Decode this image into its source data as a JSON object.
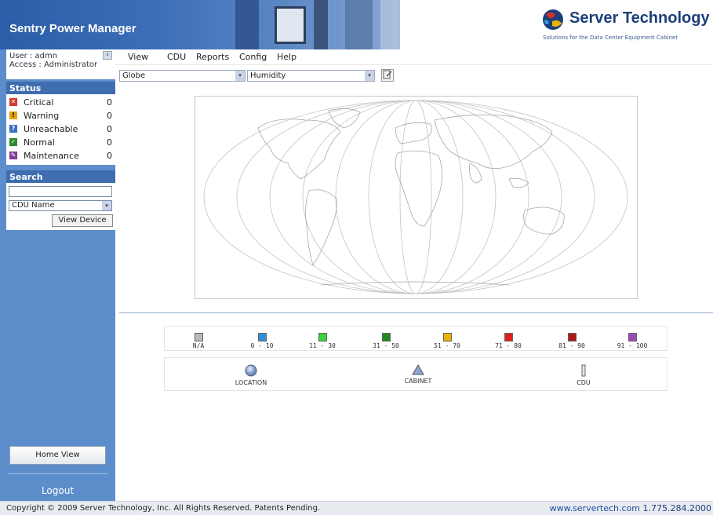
{
  "header": {
    "app_title": "Sentry Power Manager",
    "brand_name": "Server Technology",
    "brand_tagline": "Solutions for the Data Center Equipment Cabinet"
  },
  "user": {
    "user_line": "User : admn",
    "access_line": "Access : Administrator",
    "collapse_glyph": "‹"
  },
  "status": {
    "heading": "Status",
    "items": [
      {
        "label": "Critical",
        "count": "0",
        "color": "#d03a2a",
        "icon": "critical-icon",
        "glyph": "✕"
      },
      {
        "label": "Warning",
        "count": "0",
        "color": "#e0a400",
        "icon": "warning-icon",
        "glyph": "!"
      },
      {
        "label": "Unreachable",
        "count": "0",
        "color": "#3a6fc4",
        "icon": "unreachable-icon",
        "glyph": "?"
      },
      {
        "label": "Normal",
        "count": "0",
        "color": "#2c8a2c",
        "icon": "normal-icon",
        "glyph": "✓"
      },
      {
        "label": "Maintenance",
        "count": "0",
        "color": "#7d3a9a",
        "icon": "maintenance-icon",
        "glyph": "✎"
      }
    ]
  },
  "search": {
    "heading": "Search",
    "input_value": "",
    "field_selected": "CDU Name",
    "view_device_label": "View Device"
  },
  "sidebar": {
    "home_view_label": "Home View",
    "logout_label": "Logout"
  },
  "menu": {
    "items": [
      "View",
      "CDU",
      "Reports",
      "Config",
      "Help"
    ]
  },
  "toolbar": {
    "map_select": "Globe",
    "metric_select": "Humidity",
    "dropdown_glyph": "▾"
  },
  "legend_scale": {
    "items": [
      {
        "label": "N/A",
        "color": "#b8b8b8"
      },
      {
        "label": "0 - 10",
        "color": "#2f8fd8"
      },
      {
        "label": "11 - 30",
        "color": "#3ad23a"
      },
      {
        "label": "31 - 50",
        "color": "#1e8a1e"
      },
      {
        "label": "51 - 70",
        "color": "#e8b400"
      },
      {
        "label": "71 - 80",
        "color": "#e02020"
      },
      {
        "label": "81 - 90",
        "color": "#b01414"
      },
      {
        "label": "91 - 100",
        "color": "#9a4ab8"
      }
    ]
  },
  "legend_icons": {
    "location_label": "LOCATION",
    "cabinet_label": "CABINET",
    "cdu_label": "CDU"
  },
  "footer": {
    "copyright": "Copyright © 2009 Server Technology, Inc. All Rights Reserved. Patents Pending.",
    "website": "www.servertech.com",
    "phone": "1.775.284.2000"
  }
}
